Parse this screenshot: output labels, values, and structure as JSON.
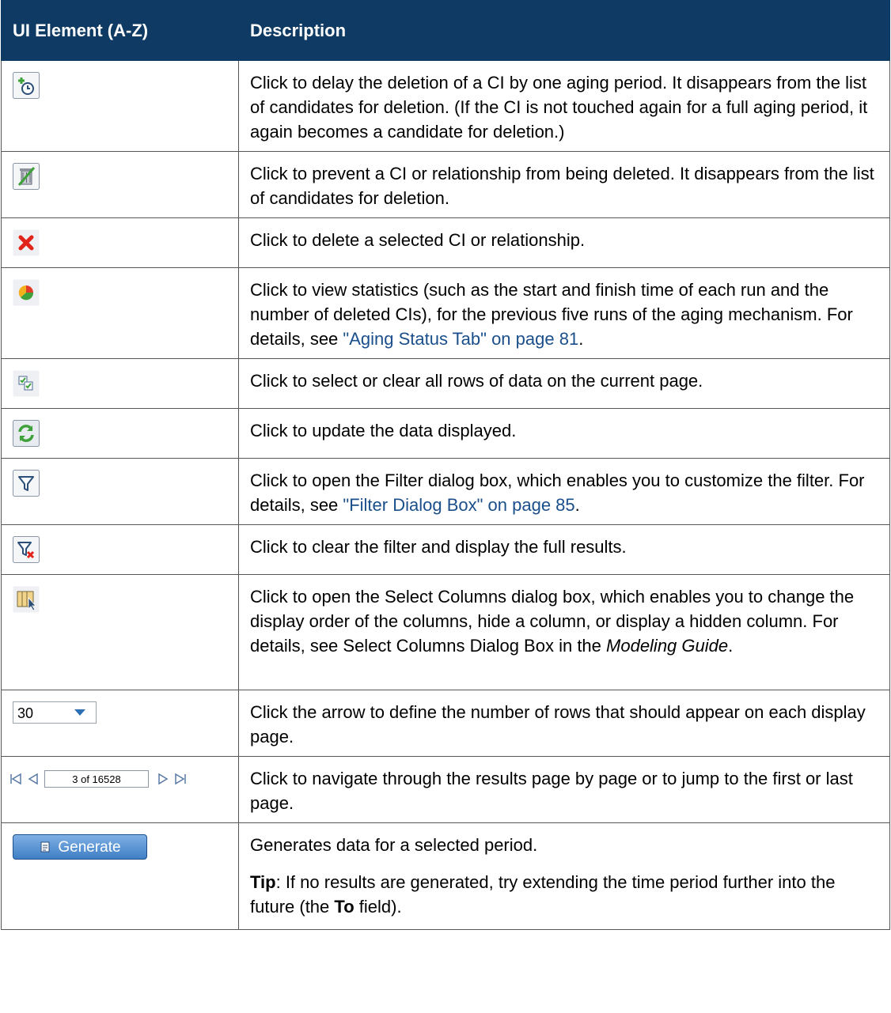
{
  "header": {
    "col1": "UI Element (A-Z)",
    "col2": "Description"
  },
  "rows": [
    {
      "icon": "delay-deletion-icon",
      "text": "Click to delay the deletion of a CI by one aging period. It disappears from the list of candidates for deletion. (If the CI is not touched again for a full aging period, it again becomes a candidate for deletion.)"
    },
    {
      "icon": "prevent-deletion-icon",
      "text": "Click to prevent a CI or relationship from being deleted. It disappears from the list of candidates for deletion."
    },
    {
      "icon": "delete-icon",
      "text": "Click to delete a selected CI or relationship."
    },
    {
      "icon": "statistics-icon",
      "text_before": "Click to view statistics (such as the start and finish time of each run and the number of deleted CIs), for the previous five runs of the aging mechanism. For details, see ",
      "link": "\"Aging Status Tab\" on page 81",
      "text_after": "."
    },
    {
      "icon": "select-all-icon",
      "text": "Click to select or clear all rows of data on the current page."
    },
    {
      "icon": "refresh-icon",
      "text": "Click to update the data displayed."
    },
    {
      "icon": "filter-icon",
      "text_before": "Click to open the Filter dialog box, which enables you to customize the filter. For details, see ",
      "link": "\"Filter Dialog Box\" on page 85",
      "text_after": "."
    },
    {
      "icon": "clear-filter-icon",
      "text": "Click to clear the filter and display the full results."
    },
    {
      "icon": "select-columns-icon",
      "text_before": "Click to open the Select Columns dialog box, which enables you to change the display order of the columns, hide a column, or display a hidden column. For details, see Select Columns Dialog Box in the ",
      "italic": "Modeling Guide",
      "text_after": "."
    },
    {
      "icon": "rows-per-page-dropdown",
      "dropdown_value": "30",
      "text": "Click the arrow to define the number of rows that should appear on each display page."
    },
    {
      "icon": "pagination-control",
      "page_value": "3 of 16528",
      "text": "Click to navigate through the results page by page or to jump to the first or last page."
    },
    {
      "icon": "generate-button",
      "button_label": "Generate",
      "text": "Generates data for a selected period.",
      "tip_label": "Tip",
      "tip_text_before": ": If no results are generated, try extending the time period further into the future (the ",
      "tip_bold": "To",
      "tip_text_after": " field)."
    }
  ]
}
